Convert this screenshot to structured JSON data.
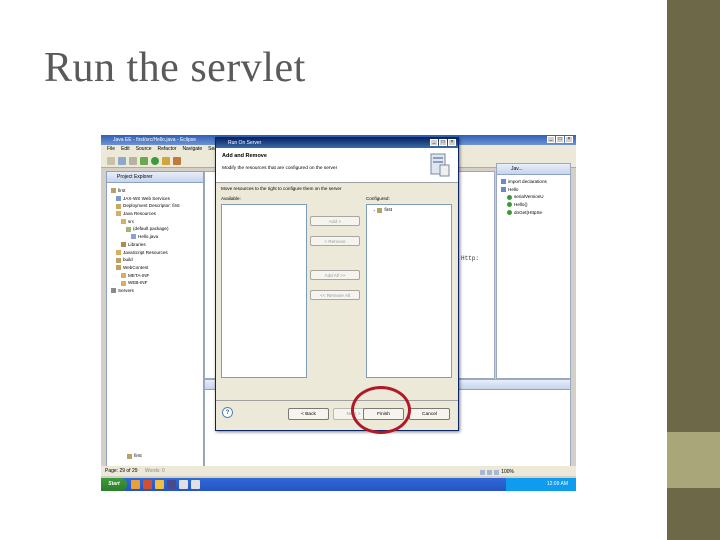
{
  "slide": {
    "title": "Run the servlet"
  },
  "eclipse": {
    "title": "Java EE - first/src/Hello.java - Eclipse",
    "menu": [
      "File",
      "Edit",
      "Source",
      "Refactor",
      "Navigate",
      "Sea"
    ],
    "project_explorer_title": "Project Explorer",
    "tree": [
      {
        "label": "first",
        "indent": 0
      },
      {
        "label": "JAX-WS Web Services",
        "indent": 1
      },
      {
        "label": "Deployment Descriptor: first",
        "indent": 1
      },
      {
        "label": "Java Resources",
        "indent": 1
      },
      {
        "label": "src",
        "indent": 2
      },
      {
        "label": "(default package)",
        "indent": 3
      },
      {
        "label": "Hello.java",
        "indent": 4
      },
      {
        "label": "Libraries",
        "indent": 2
      },
      {
        "label": "JavaScript Resources",
        "indent": 1
      },
      {
        "label": "build",
        "indent": 1
      },
      {
        "label": "WebContent",
        "indent": 1
      },
      {
        "label": "META-INF",
        "indent": 2
      },
      {
        "label": "WEB-INF",
        "indent": 2
      },
      {
        "label": "Servers",
        "indent": 0
      }
    ],
    "outline_title": "Jav...",
    "outline_items": [
      {
        "label": "import declarations",
        "indent": 0
      },
      {
        "label": "Hello",
        "indent": 0
      },
      {
        "label": "serialVersionU",
        "indent": 1
      },
      {
        "label": "Hello()",
        "indent": 1
      },
      {
        "label": "doGet(HttpSe",
        "indent": 1
      }
    ],
    "editor_text": "Http:",
    "bottom_left_label": "first",
    "status_left": "Page: 29 of 29",
    "status_words": "Words: 0",
    "zoom": "100%",
    "clock": "12:09 AM",
    "start_label": "Start"
  },
  "dialog": {
    "title": "Run On Server",
    "heading": "Add and Remove",
    "subheading": "Modify the resources that are configured on the server",
    "description": "Move resources to the right to configure them on the server",
    "available_label": "Available:",
    "configured_label": "Configured:",
    "configured_items": [
      "first"
    ],
    "add_button": "Add >",
    "remove_button": "< Remove",
    "add_all_button": "Add All >>",
    "remove_all_button": "<< Remove All",
    "back_button": "< Back",
    "next_button": "Next >",
    "finish_button": "Finish",
    "cancel_button": "Cancel",
    "help_label": "?"
  },
  "colors": {
    "annotation_circle": "#b01a28",
    "sidebar_dark": "#6d6848",
    "sidebar_light": "#a9a67a"
  }
}
